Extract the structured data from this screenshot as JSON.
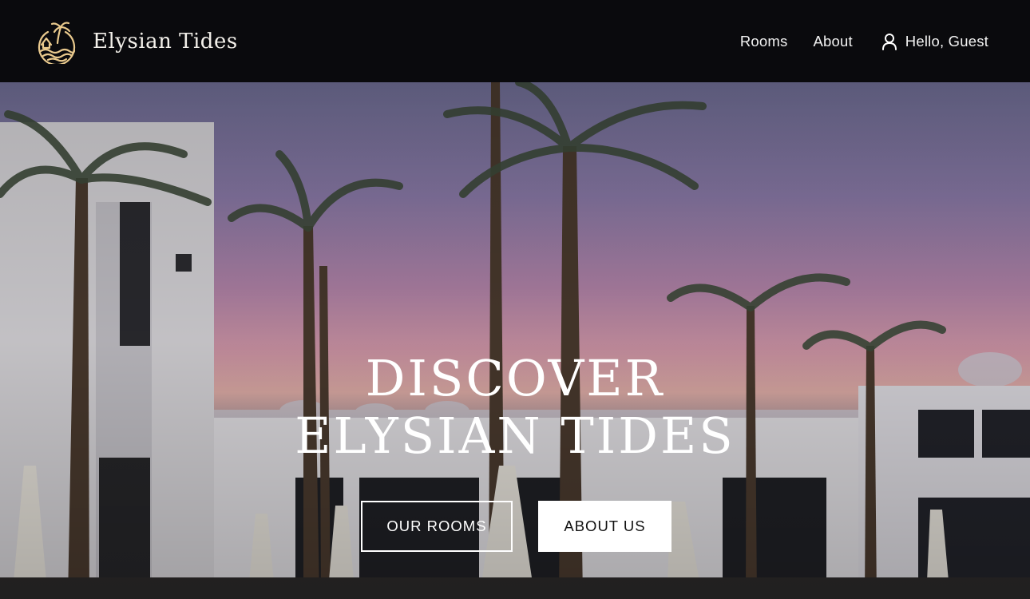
{
  "brand": {
    "name": "Elysian Tides",
    "logo_icon": "palm-island-wave-icon",
    "accent_color": "#e9c98d"
  },
  "nav": {
    "links": [
      "Rooms",
      "About"
    ],
    "account": {
      "icon": "user-icon",
      "label": "Hello, Guest"
    }
  },
  "hero": {
    "title_line1": "DISCOVER",
    "title_line2": "ELYSIAN TIDES",
    "buttons": {
      "primary": "OUR ROOMS",
      "secondary": "ABOUT US"
    },
    "background": "resort courtyard with palm trees at dusk"
  },
  "colors": {
    "header_bg": "#0a0a0d",
    "text": "#ffffff",
    "button_solid_bg": "#ffffff"
  }
}
